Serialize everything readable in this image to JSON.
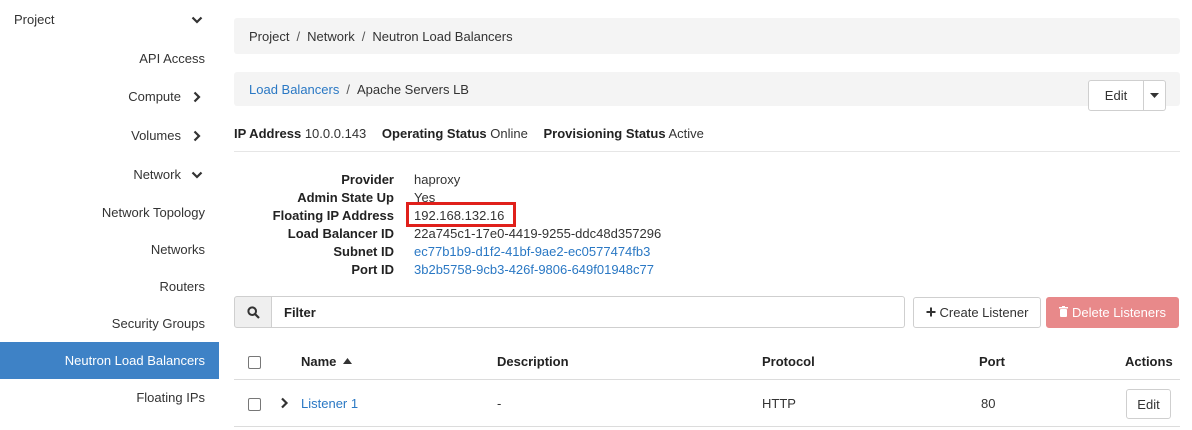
{
  "sidebar": {
    "project": "Project",
    "items": [
      {
        "label": "API Access"
      },
      {
        "label": "Compute"
      },
      {
        "label": "Volumes"
      },
      {
        "label": "Network"
      },
      {
        "label": "Network Topology"
      },
      {
        "label": "Networks"
      },
      {
        "label": "Routers"
      },
      {
        "label": "Security Groups"
      },
      {
        "label": "Neutron Load Balancers"
      },
      {
        "label": "Floating IPs"
      }
    ],
    "active_color": "#3e82c6"
  },
  "breadcrumb": [
    "Project",
    "Network",
    "Neutron Load Balancers"
  ],
  "breadcrumb_sep": "/",
  "title": {
    "parent_link": "Load Balancers",
    "sep": "/",
    "current": "Apache Servers LB"
  },
  "actions": {
    "edit_label": "Edit"
  },
  "status": {
    "ip_label": "IP Address",
    "ip_value": "10.0.0.143",
    "op_label": "Operating Status",
    "op_value": "Online",
    "prov_label": "Provisioning Status",
    "prov_value": "Active"
  },
  "details": [
    {
      "term": "Provider",
      "value": "haproxy"
    },
    {
      "term": "Admin State Up",
      "value": "Yes"
    },
    {
      "term": "Floating IP Address",
      "value": "192.168.132.16"
    },
    {
      "term": "Load Balancer ID",
      "value": "22a745c1-17e0-4419-9255-ddc48d357296"
    },
    {
      "term": "Subnet ID",
      "value": "ec77b1b9-d1f2-41bf-9ae2-ec0577474fb3"
    },
    {
      "term": "Port ID",
      "value": "3b2b5758-9cb3-426f-9806-649f01948c77"
    }
  ],
  "toolbar": {
    "filter_placeholder": "Filter",
    "create_label": "Create Listener",
    "delete_label": "Delete Listeners"
  },
  "table": {
    "headers": {
      "name": "Name",
      "description": "Description",
      "protocol": "Protocol",
      "port": "Port",
      "actions": "Actions"
    },
    "rows": [
      {
        "name": "Listener 1",
        "description": "-",
        "protocol": "HTTP",
        "port": "80",
        "action": "Edit"
      }
    ]
  },
  "colors": {
    "link": "#2a78c4",
    "highlight": "#e0201b",
    "danger": "#e8898a"
  }
}
